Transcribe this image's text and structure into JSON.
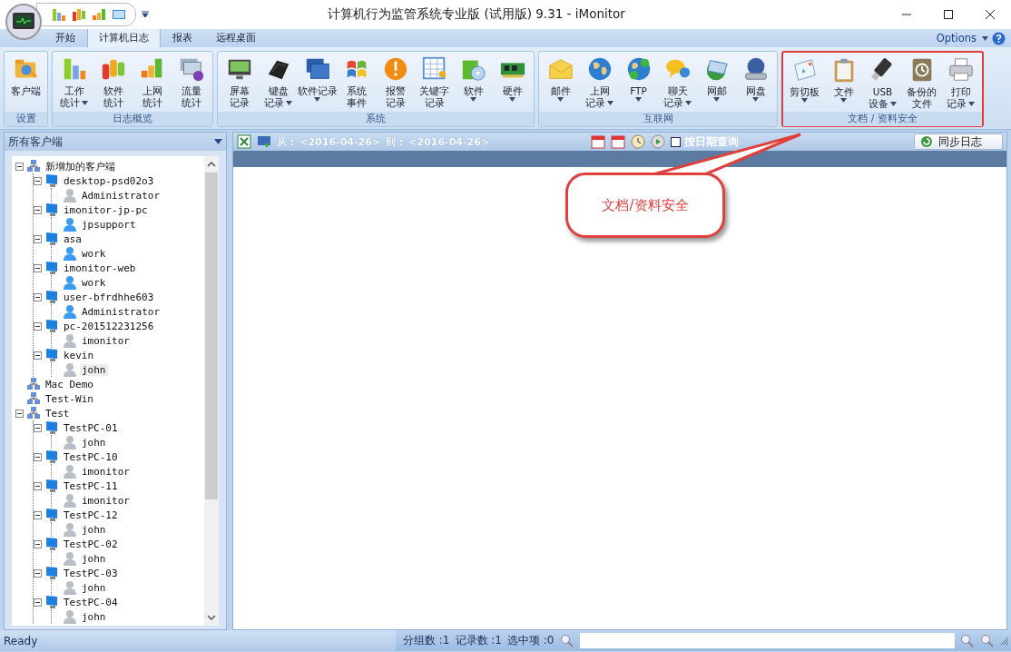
{
  "window": {
    "title": "计算机行为监管系统专业版 (试用版) 9.31 - iMonitor"
  },
  "tabs": [
    {
      "label": "开始",
      "selected": false
    },
    {
      "label": "计算机日志",
      "selected": true
    },
    {
      "label": "报表",
      "selected": false
    },
    {
      "label": "远程桌面",
      "selected": false
    }
  ],
  "options_menu": {
    "label": "Options"
  },
  "ribbon_groups": [
    {
      "title": "设置",
      "highlighted": false,
      "buttons": [
        {
          "lines": [
            "客户端"
          ],
          "dropdown": false
        }
      ]
    },
    {
      "title": "日志概览",
      "highlighted": false,
      "buttons": [
        {
          "lines": [
            "工作",
            "统计"
          ],
          "dropdown": true
        },
        {
          "lines": [
            "软件",
            "统计"
          ],
          "dropdown": false
        },
        {
          "lines": [
            "上网",
            "统计"
          ],
          "dropdown": false
        },
        {
          "lines": [
            "流量",
            "统计"
          ],
          "dropdown": false
        }
      ]
    },
    {
      "title": "系统",
      "highlighted": false,
      "buttons": [
        {
          "lines": [
            "屏幕",
            "记录"
          ],
          "dropdown": false
        },
        {
          "lines": [
            "键盘",
            "记录"
          ],
          "dropdown": true
        },
        {
          "lines": [
            "软件记录"
          ],
          "dropdown": true
        },
        {
          "lines": [
            "系统",
            "事件"
          ],
          "dropdown": false
        },
        {
          "lines": [
            "报警",
            "记录"
          ],
          "dropdown": false
        },
        {
          "lines": [
            "关键字",
            "记录"
          ],
          "dropdown": false
        },
        {
          "lines": [
            "软件"
          ],
          "dropdown": true
        },
        {
          "lines": [
            "硬件"
          ],
          "dropdown": true
        }
      ]
    },
    {
      "title": "互联网",
      "highlighted": false,
      "buttons": [
        {
          "lines": [
            "邮件"
          ],
          "dropdown": true
        },
        {
          "lines": [
            "上网",
            "记录"
          ],
          "dropdown": true
        },
        {
          "lines": [
            "FTP"
          ],
          "dropdown": true
        },
        {
          "lines": [
            "聊天",
            "记录"
          ],
          "dropdown": true
        },
        {
          "lines": [
            "网邮"
          ],
          "dropdown": true
        },
        {
          "lines": [
            "网盘"
          ],
          "dropdown": true
        }
      ]
    },
    {
      "title": "文档 / 资料安全",
      "highlighted": true,
      "buttons": [
        {
          "lines": [
            "剪切板"
          ],
          "dropdown": true
        },
        {
          "lines": [
            "文件"
          ],
          "dropdown": true
        },
        {
          "lines": [
            "USB",
            "设备"
          ],
          "dropdown": true
        },
        {
          "lines": [
            "备份的",
            "文件"
          ],
          "dropdown": false
        },
        {
          "lines": [
            "打印",
            "记录"
          ],
          "dropdown": true
        }
      ]
    }
  ],
  "client_panel": {
    "title": "所有客户端"
  },
  "tree": [
    {
      "kind": "group",
      "label": "新增加的客户端",
      "expanded": true,
      "selected": false,
      "children": [
        {
          "kind": "computer",
          "label": "desktop-psd02o3",
          "expanded": true,
          "selected": false,
          "children": [
            {
              "kind": "user",
              "label": "Administrator",
              "online": false,
              "selected": false
            }
          ]
        },
        {
          "kind": "computer",
          "label": "imonitor-jp-pc",
          "expanded": true,
          "selected": false,
          "children": [
            {
              "kind": "user",
              "label": "jpsupport",
              "online": true,
              "selected": false
            }
          ]
        },
        {
          "kind": "computer",
          "label": "asa",
          "expanded": true,
          "selected": false,
          "children": [
            {
              "kind": "user",
              "label": "work",
              "online": true,
              "selected": false
            }
          ]
        },
        {
          "kind": "computer",
          "label": "imonitor-web",
          "expanded": true,
          "selected": false,
          "children": [
            {
              "kind": "user",
              "label": "work",
              "online": true,
              "selected": false
            }
          ]
        },
        {
          "kind": "computer",
          "label": "user-bfrdhhe603",
          "expanded": true,
          "selected": false,
          "children": [
            {
              "kind": "user",
              "label": "Administrator",
              "online": true,
              "selected": false
            }
          ]
        },
        {
          "kind": "computer",
          "label": "pc-201512231256",
          "expanded": true,
          "selected": false,
          "children": [
            {
              "kind": "user",
              "label": "imonitor",
              "online": false,
              "selected": false
            }
          ]
        },
        {
          "kind": "computer",
          "label": "kevin",
          "expanded": true,
          "selected": false,
          "children": [
            {
              "kind": "user",
              "label": "john",
              "online": false,
              "selected": true
            }
          ]
        }
      ]
    },
    {
      "kind": "group",
      "label": "Mac Demo",
      "selected": false
    },
    {
      "kind": "group",
      "label": "Test-Win",
      "selected": false
    },
    {
      "kind": "group",
      "label": "Test",
      "expanded": true,
      "selected": false,
      "children": [
        {
          "kind": "computer",
          "label": "TestPC-01",
          "expanded": true,
          "selected": false,
          "children": [
            {
              "kind": "user",
              "label": "john",
              "online": false,
              "selected": false
            }
          ]
        },
        {
          "kind": "computer",
          "label": "TestPC-10",
          "expanded": true,
          "selected": false,
          "children": [
            {
              "kind": "user",
              "label": "imonitor",
              "online": false,
              "selected": false
            }
          ]
        },
        {
          "kind": "computer",
          "label": "TestPC-11",
          "expanded": true,
          "selected": false,
          "children": [
            {
              "kind": "user",
              "label": "imonitor",
              "online": false,
              "selected": false
            }
          ]
        },
        {
          "kind": "computer",
          "label": "TestPC-12",
          "expanded": true,
          "selected": false,
          "children": [
            {
              "kind": "user",
              "label": "john",
              "online": false,
              "selected": false
            }
          ]
        },
        {
          "kind": "computer",
          "label": "TestPC-02",
          "expanded": true,
          "selected": false,
          "children": [
            {
              "kind": "user",
              "label": "john",
              "online": false,
              "selected": false
            }
          ]
        },
        {
          "kind": "computer",
          "label": "TestPC-03",
          "expanded": true,
          "selected": false,
          "children": [
            {
              "kind": "user",
              "label": "john",
              "online": false,
              "selected": false
            }
          ]
        },
        {
          "kind": "computer",
          "label": "TestPC-04",
          "expanded": true,
          "selected": false,
          "children": [
            {
              "kind": "user",
              "label": "john",
              "online": false,
              "selected": false
            }
          ]
        }
      ]
    }
  ],
  "log_toolbar": {
    "from_label": "从 :",
    "from_value": "<2016-04-26>",
    "to_label": "到 :",
    "to_value": "<2016-04-26>",
    "date_query": {
      "label": "按日期查询",
      "checked": false
    },
    "sync_button": "同步日志"
  },
  "callout": {
    "text": "文档/资料安全"
  },
  "status_bar": {
    "status": "Ready",
    "group_count": "分组数 :1",
    "record_count": "记录数 :1",
    "selected_count": "选中项 :0"
  }
}
